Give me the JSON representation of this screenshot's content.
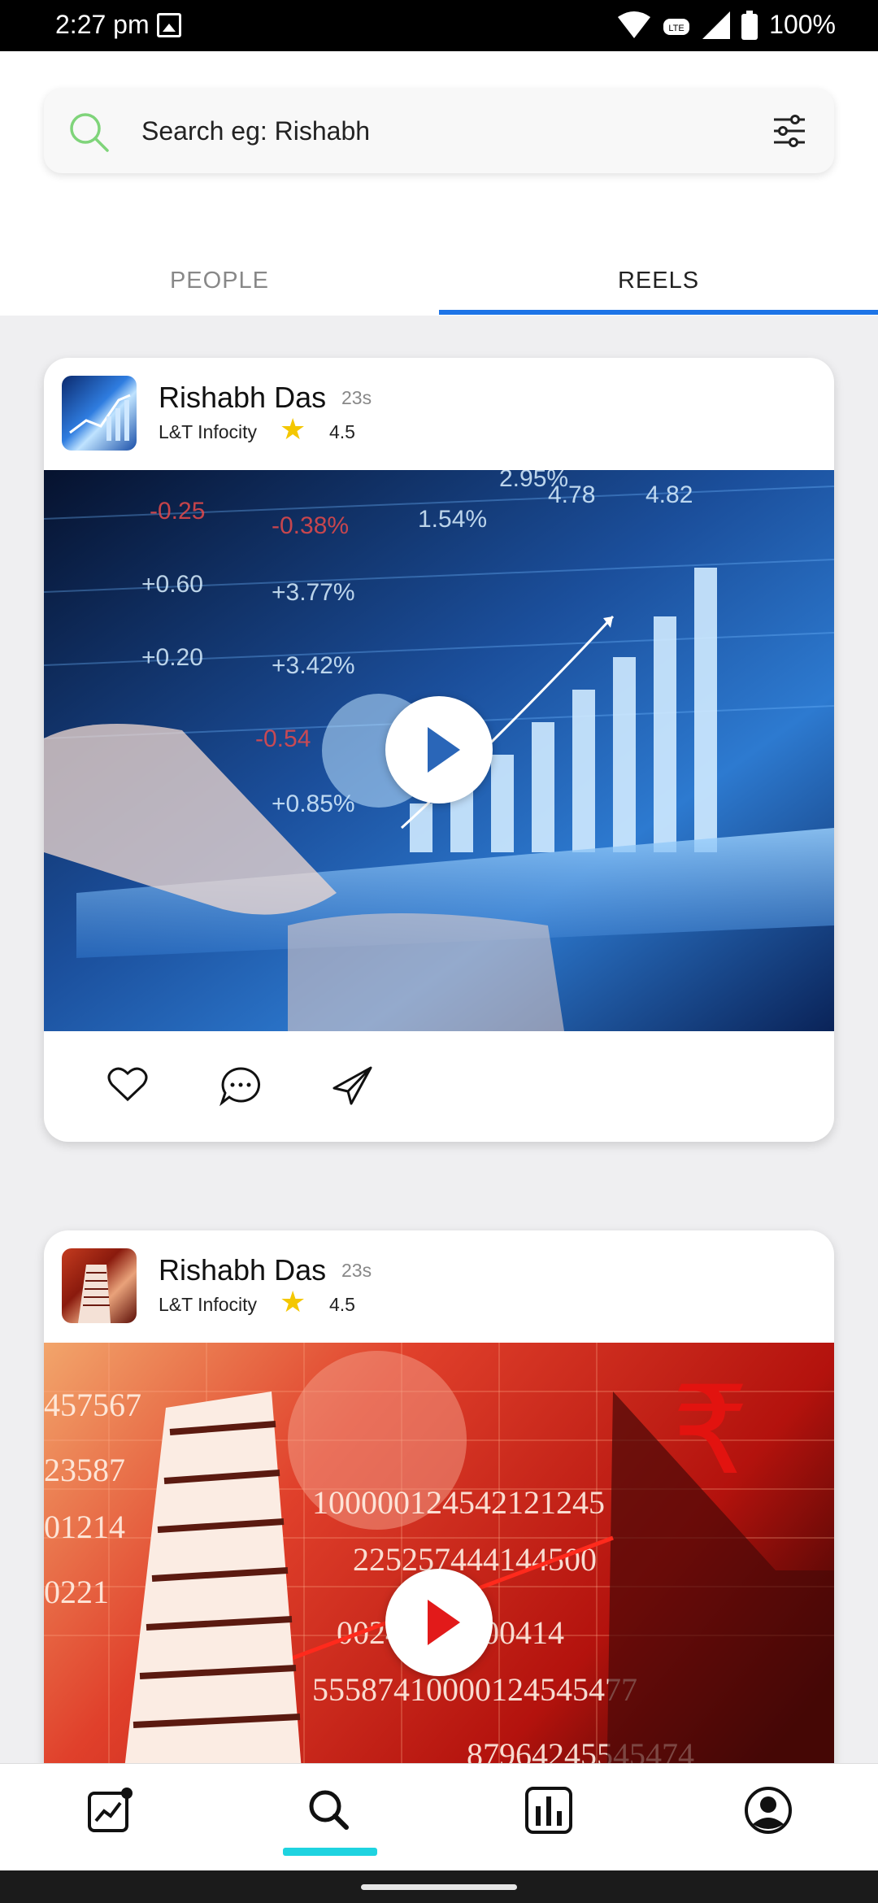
{
  "status_bar": {
    "time": "2:27 pm",
    "battery": "100%",
    "icons": [
      "gallery-icon",
      "wifi-icon",
      "volte-icon",
      "signal-icon",
      "battery-icon"
    ]
  },
  "search": {
    "placeholder": "Search eg: Rishabh",
    "icon": "search-icon",
    "filter_icon": "sliders-icon"
  },
  "tabs": [
    {
      "label": "PEOPLE",
      "selected": false
    },
    {
      "label": "REELS",
      "selected": true
    }
  ],
  "accent_color": "#1d74e7",
  "posts": [
    {
      "name": "Rishabh Das",
      "time_ago": "23s",
      "company": "L&T Infocity",
      "rating": "4.5",
      "thumbnail": "stock-chart-tablet",
      "play_color": "#2a66b8"
    },
    {
      "name": "Rishabh Das",
      "time_ago": "23s",
      "company": "L&T Infocity",
      "rating": "4.5",
      "thumbnail": "stock-exchange-rupee",
      "play_color": "#e21a1a"
    }
  ],
  "post_actions": [
    "heart-icon",
    "comment-icon",
    "send-icon"
  ],
  "bottom_nav": [
    {
      "icon": "trending-chart-icon",
      "selected": false,
      "has_badge": true
    },
    {
      "icon": "search-icon",
      "selected": true
    },
    {
      "icon": "bar-chart-icon",
      "selected": false
    },
    {
      "icon": "account-icon",
      "selected": false
    }
  ],
  "nav_indicator_color": "#1fd3e0"
}
